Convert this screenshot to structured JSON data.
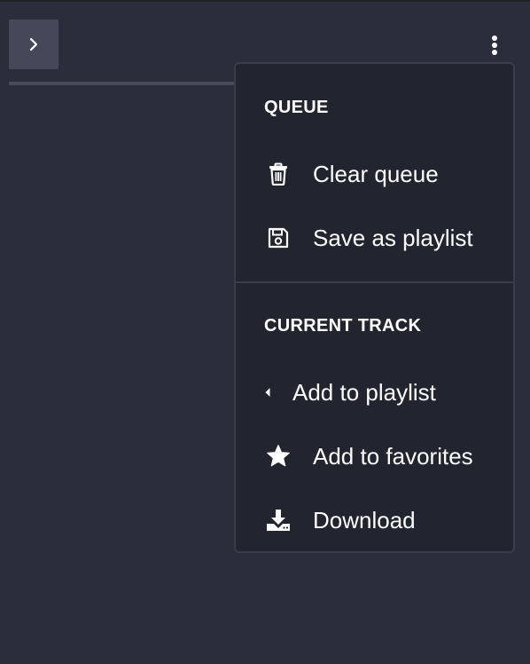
{
  "toolbar": {
    "expand_icon": "chevron-right-icon",
    "more_icon": "kebab-vertical-icon"
  },
  "menu": {
    "queue": {
      "title": "QUEUE",
      "items": [
        {
          "label": "Clear queue",
          "icon": "trash-icon"
        },
        {
          "label": "Save as playlist",
          "icon": "floppy-disk-icon"
        }
      ]
    },
    "current_track": {
      "title": "CURRENT TRACK",
      "items": [
        {
          "label": "Add to playlist",
          "icon": "caret-left-icon"
        },
        {
          "label": "Add to favorites",
          "icon": "star-icon"
        },
        {
          "label": "Download",
          "icon": "download-icon"
        }
      ]
    }
  },
  "colors": {
    "background": "#2a2d3a",
    "menu_background": "#22242f",
    "button_background": "#444859",
    "text": "#ffffff"
  }
}
